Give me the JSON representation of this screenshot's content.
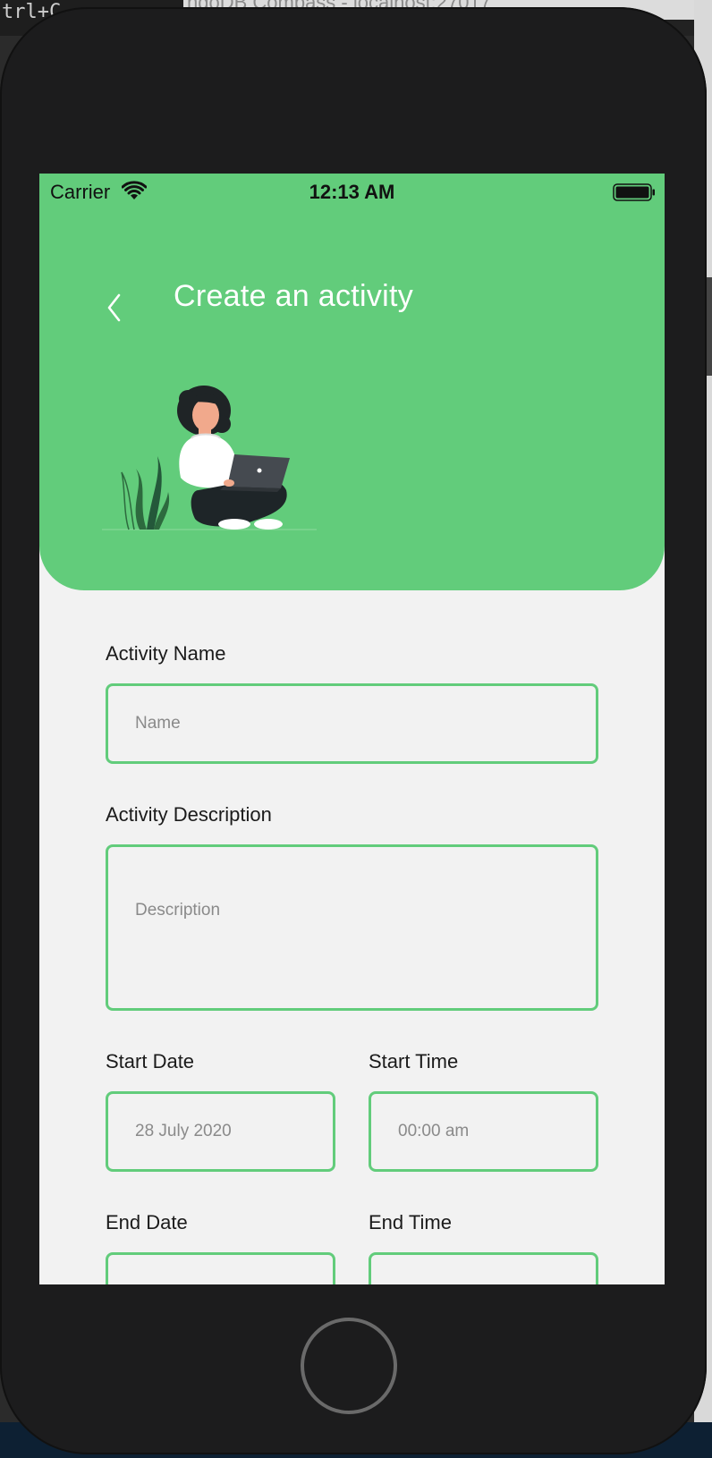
{
  "background": {
    "terminal_text": "trl+C",
    "window_title": "ngoDB Compass - localhost:27017"
  },
  "status_bar": {
    "carrier": "Carrier",
    "time": "12:13 AM",
    "wifi_icon": "wifi-icon",
    "battery_icon": "battery-icon"
  },
  "header": {
    "title": "Create an activity",
    "back_icon": "chevron-left-icon",
    "color": "#62cc7b"
  },
  "form": {
    "name": {
      "label": "Activity Name",
      "placeholder": "Name"
    },
    "description": {
      "label": "Activity Description",
      "placeholder": "Description"
    },
    "start_date": {
      "label": "Start Date",
      "placeholder": "28 July 2020"
    },
    "start_time": {
      "label": "Start Time",
      "placeholder": "00:00 am"
    },
    "end_date": {
      "label": "End Date"
    },
    "end_time": {
      "label": "End Time"
    }
  }
}
